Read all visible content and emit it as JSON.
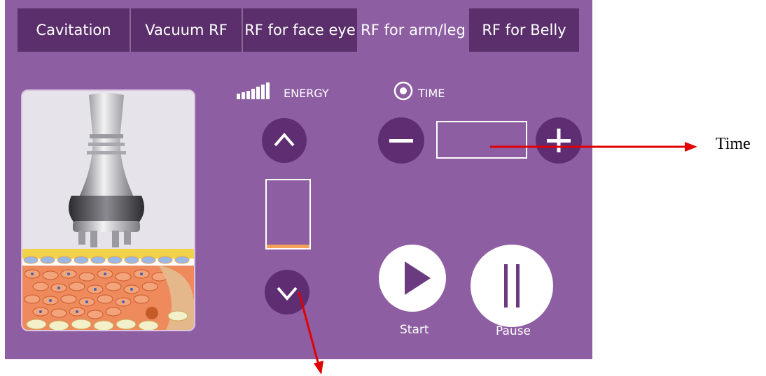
{
  "tabs": [
    {
      "label": "Cavitation",
      "active": false
    },
    {
      "label": "Vacuum RF",
      "active": false
    },
    {
      "label": "RF for face eye",
      "active": false
    },
    {
      "label": "RF for arm/leg",
      "active": true
    },
    {
      "label": "RF for Belly",
      "active": false
    }
  ],
  "energy": {
    "label": "ENERGY",
    "level_fraction": 0.05
  },
  "time": {
    "label": "TIME",
    "value": ""
  },
  "controls": {
    "start_label": "Start",
    "pause_label": "Pause"
  },
  "annotations": {
    "time_callout": "Time"
  },
  "colors": {
    "background": "#8e5ea2",
    "tab_bar": "#5a2f6b",
    "button_dark": "#5e2d72",
    "energy_fill": "#f2a25a",
    "annotation_arrow": "#e00000"
  }
}
